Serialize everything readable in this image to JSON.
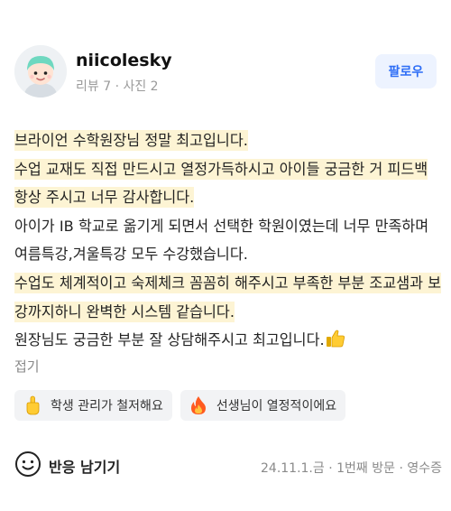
{
  "reviewer": {
    "name": "niicolesky",
    "meta": "리뷰 7 · 사진 2",
    "follow_label": "팔로우"
  },
  "review": {
    "lines": [
      {
        "text": "브라이언 수학원장님 정말 최고입니다.",
        "highlighted": true
      },
      {
        "text": "수업 교재도 직접 만드시고 열정가득하시고 아이들 궁금한 거 피드백 항상 주시고 너무 감사합니다.",
        "highlighted": true
      },
      {
        "text": "아이가 IB 학교로 옮기게 되면서 선택한 학원이였는데 너무 만족하며 여름특강,겨울특강 모두 수강했습니다.",
        "highlighted": false
      },
      {
        "text": "수업도 체계적이고 숙제체크 꼼꼼히 해주시고 부족한 부분 조교샘과 보강까지하니 완벽한 시스템 같습니다.",
        "highlighted": true
      },
      {
        "text": "원장님도 궁금한 부분 잘 상담해주시고 최고입니다.",
        "highlighted": false
      }
    ],
    "fold_label": "접기"
  },
  "tags": [
    {
      "label": "학생 관리가 철저해요",
      "icon": "pointing-finger-icon"
    },
    {
      "label": "선생님이 열정적이에요",
      "icon": "fire-icon"
    }
  ],
  "footer": {
    "react_label": "반응 남기기",
    "visit_info": "24.11.1.금 · 1번째 방문 · 영수증"
  },
  "colors": {
    "highlight": "#fdf4d4",
    "follow_text": "#2d6df6",
    "follow_bg": "#edf3ff",
    "tag_bg": "#f2f3f5"
  }
}
